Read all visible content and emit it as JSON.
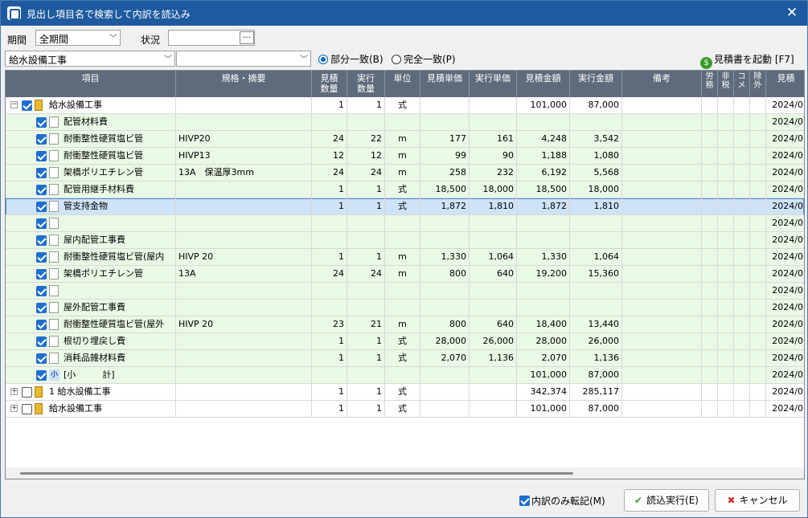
{
  "window": {
    "title": "見出し項目名で検索して内訳を読込み"
  },
  "filters": {
    "period_label": "期間",
    "period_value": "全期間",
    "status_label": "状況",
    "status_value": "",
    "item_value": "給水設備工事",
    "spec_value": "",
    "match_partial": "部分一致(B)",
    "match_exact": "完全一致(P)",
    "launch_estimate": "見積書を起動 [F7]"
  },
  "columns": [
    "項目",
    "規格・摘要",
    "見積\n数量",
    "実行\n数量",
    "単位",
    "見積単価",
    "実行単価",
    "見積金額",
    "実行金額",
    "備考",
    "労務",
    "非税",
    "コメ",
    "除外",
    "見積"
  ],
  "rows": [
    {
      "level": 0,
      "expand": "−",
      "checked": true,
      "icon": "doc",
      "name": "給水設備工事",
      "spec": "",
      "eq": "1",
      "aq": "1",
      "unit": "式",
      "ep": "",
      "ap": "",
      "ea": "101,000",
      "aa": "87,000",
      "date": "2024/0",
      "bg": "#ffffff"
    },
    {
      "level": 1,
      "checked": true,
      "icon": "sq",
      "name": "配管材料費",
      "spec": "",
      "eq": "",
      "aq": "",
      "unit": "",
      "ep": "",
      "ap": "",
      "ea": "",
      "aa": "",
      "date": "2024/0",
      "bg": "#eaf8e6"
    },
    {
      "level": 1,
      "checked": true,
      "icon": "sq",
      "name": "耐衝整性硬質塩ビ管",
      "spec": "HIVP20",
      "eq": "24",
      "aq": "22",
      "unit": "m",
      "ep": "177",
      "ap": "161",
      "ea": "4,248",
      "aa": "3,542",
      "date": "2024/0",
      "bg": "#eaf8e6"
    },
    {
      "level": 1,
      "checked": true,
      "icon": "sq",
      "name": "耐衝整性硬質塩ビ管",
      "spec": "HIVP13",
      "eq": "12",
      "aq": "12",
      "unit": "m",
      "ep": "99",
      "ap": "90",
      "ea": "1,188",
      "aa": "1,080",
      "date": "2024/0",
      "bg": "#eaf8e6"
    },
    {
      "level": 1,
      "checked": true,
      "icon": "sq",
      "name": "架橋ポリエチレン管",
      "spec": "13A　保温厚3mm",
      "eq": "24",
      "aq": "24",
      "unit": "m",
      "ep": "258",
      "ap": "232",
      "ea": "6,192",
      "aa": "5,568",
      "date": "2024/0",
      "bg": "#eaf8e6"
    },
    {
      "level": 1,
      "checked": true,
      "icon": "sq",
      "name": "配管用継手材料費",
      "spec": "",
      "eq": "1",
      "aq": "1",
      "unit": "式",
      "ep": "18,500",
      "ap": "18,000",
      "ea": "18,500",
      "aa": "18,000",
      "date": "2024/0",
      "bg": "#eaf8e6"
    },
    {
      "level": 1,
      "checked": true,
      "icon": "sq",
      "name": "管支持金物",
      "spec": "",
      "eq": "1",
      "aq": "1",
      "unit": "式",
      "ep": "1,872",
      "ap": "1,810",
      "ea": "1,872",
      "aa": "1,810",
      "date": "2024/0",
      "bg": "#cfe3f8",
      "selected": true
    },
    {
      "level": 1,
      "checked": true,
      "icon": "sq",
      "name": "",
      "spec": "",
      "eq": "",
      "aq": "",
      "unit": "",
      "ep": "",
      "ap": "",
      "ea": "",
      "aa": "",
      "date": "2024/0",
      "bg": "#eaf8e6"
    },
    {
      "level": 1,
      "checked": true,
      "icon": "sq",
      "name": "屋内配管工事費",
      "spec": "",
      "eq": "",
      "aq": "",
      "unit": "",
      "ep": "",
      "ap": "",
      "ea": "",
      "aa": "",
      "date": "2024/0",
      "bg": "#eaf8e6"
    },
    {
      "level": 1,
      "checked": true,
      "icon": "sq",
      "name": "耐衝整性硬質塩ビ管(屋内",
      "spec": "HIVP 20",
      "eq": "1",
      "aq": "1",
      "unit": "m",
      "ep": "1,330",
      "ap": "1,064",
      "ea": "1,330",
      "aa": "1,064",
      "date": "2024/0",
      "bg": "#eaf8e6"
    },
    {
      "level": 1,
      "checked": true,
      "icon": "sq",
      "name": "架橋ポリエチレン管",
      "spec": "13A",
      "eq": "24",
      "aq": "24",
      "unit": "m",
      "ep": "800",
      "ap": "640",
      "ea": "19,200",
      "aa": "15,360",
      "date": "2024/0",
      "bg": "#eaf8e6"
    },
    {
      "level": 1,
      "checked": true,
      "icon": "sq",
      "name": "",
      "spec": "",
      "eq": "",
      "aq": "",
      "unit": "",
      "ep": "",
      "ap": "",
      "ea": "",
      "aa": "",
      "date": "2024/0",
      "bg": "#eaf8e6"
    },
    {
      "level": 1,
      "checked": true,
      "icon": "sq",
      "name": "屋外配管工事費",
      "spec": "",
      "eq": "",
      "aq": "",
      "unit": "",
      "ep": "",
      "ap": "",
      "ea": "",
      "aa": "",
      "date": "2024/0",
      "bg": "#eaf8e6"
    },
    {
      "level": 1,
      "checked": true,
      "icon": "sq",
      "name": "耐衝整性硬質塩ビ管(屋外",
      "spec": "HIVP 20",
      "eq": "23",
      "aq": "21",
      "unit": "m",
      "ep": "800",
      "ap": "640",
      "ea": "18,400",
      "aa": "13,440",
      "date": "2024/0",
      "bg": "#eaf8e6"
    },
    {
      "level": 1,
      "checked": true,
      "icon": "sq",
      "name": "根切り埋戻し費",
      "spec": "",
      "eq": "1",
      "aq": "1",
      "unit": "式",
      "ep": "28,000",
      "ap": "26,000",
      "ea": "28,000",
      "aa": "26,000",
      "date": "2024/0",
      "bg": "#eaf8e6"
    },
    {
      "level": 1,
      "checked": true,
      "icon": "sq",
      "name": "消耗品雑材料費",
      "spec": "",
      "eq": "1",
      "aq": "1",
      "unit": "式",
      "ep": "2,070",
      "ap": "1,136",
      "ea": "2,070",
      "aa": "1,136",
      "date": "2024/0",
      "bg": "#eaf8e6"
    },
    {
      "level": 1,
      "checked": true,
      "icon": "small",
      "name": "[小　　　計]",
      "spec": "",
      "eq": "",
      "aq": "",
      "unit": "",
      "ep": "",
      "ap": "",
      "ea": "101,000",
      "aa": "87,000",
      "date": "2024/0",
      "bg": "#eaf8e6"
    },
    {
      "level": 0,
      "expand": "+",
      "checked": false,
      "icon": "doc",
      "name": "1 給水設備工事",
      "spec": "",
      "eq": "1",
      "aq": "1",
      "unit": "式",
      "ep": "",
      "ap": "",
      "ea": "342,374",
      "aa": "285,117",
      "date": "2024/0",
      "bg": "#ffffff"
    },
    {
      "level": 0,
      "expand": "+",
      "checked": false,
      "icon": "doc",
      "name": "給水設備工事",
      "spec": "",
      "eq": "1",
      "aq": "1",
      "unit": "式",
      "ep": "",
      "ap": "",
      "ea": "101,000",
      "aa": "87,000",
      "date": "2024/0",
      "bg": "#ffffff"
    }
  ],
  "footer": {
    "transfer_only": "内訳のみ転記(M)",
    "execute": "読込実行(E)",
    "cancel": "キャンセル"
  }
}
